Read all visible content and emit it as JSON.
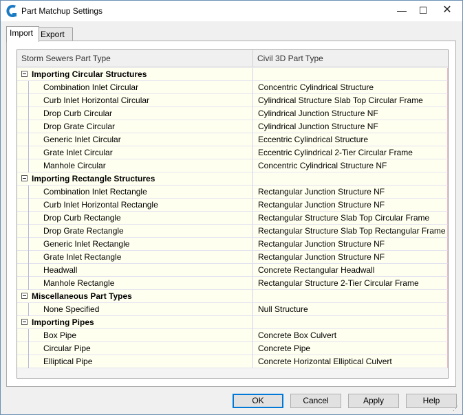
{
  "window": {
    "title": "Part Matchup Settings",
    "controls": {
      "minimize": "—",
      "maximize": "☐",
      "close": "✕"
    }
  },
  "tabs": [
    {
      "label": "Import",
      "active": true
    },
    {
      "label": "Export",
      "active": false
    }
  ],
  "table": {
    "headers": [
      "Storm Sewers Part Type",
      "Civil 3D Part Type"
    ],
    "groups": [
      {
        "label": "Importing Circular Structures",
        "items": [
          [
            "Combination Inlet Circular",
            "Concentric Cylindrical Structure"
          ],
          [
            "Curb Inlet Horizontal Circular",
            "Cylindrical Structure Slab Top Circular Frame"
          ],
          [
            "Drop Curb Circular",
            "Cylindrical Junction Structure NF"
          ],
          [
            "Drop Grate Circular",
            "Cylindrical Junction Structure NF"
          ],
          [
            "Generic Inlet Circular",
            "Eccentric Cylindrical Structure"
          ],
          [
            "Grate Inlet Circular",
            "Eccentric Cylindrical 2-Tier Circular Frame"
          ],
          [
            "Manhole Circular",
            "Concentric Cylindrical Structure NF"
          ]
        ]
      },
      {
        "label": "Importing Rectangle Structures",
        "items": [
          [
            "Combination Inlet Rectangle",
            "Rectangular Junction Structure NF"
          ],
          [
            "Curb Inlet Horizontal Rectangle",
            "Rectangular Junction Structure NF"
          ],
          [
            "Drop Curb Rectangle",
            "Rectangular Structure Slab Top Circular Frame"
          ],
          [
            "Drop Grate Rectangle",
            "Rectangular Structure Slab Top Rectangular Frame"
          ],
          [
            "Generic Inlet Rectangle",
            "Rectangular Junction Structure NF"
          ],
          [
            "Grate Inlet Rectangle",
            "Rectangular Junction Structure NF"
          ],
          [
            "Headwall",
            "Concrete Rectangular Headwall"
          ],
          [
            "Manhole Rectangle",
            "Rectangular Structure 2-Tier Circular Frame"
          ]
        ]
      },
      {
        "label": "Miscellaneous Part Types",
        "items": [
          [
            "None Specified",
            "Null Structure"
          ]
        ]
      },
      {
        "label": "Importing Pipes",
        "items": [
          [
            "Box Pipe",
            "Concrete Box Culvert"
          ],
          [
            "Circular Pipe",
            "Concrete Pipe"
          ],
          [
            "Elliptical Pipe",
            "Concrete Horizontal Elliptical Culvert"
          ]
        ]
      }
    ]
  },
  "buttons": {
    "ok": "OK",
    "cancel": "Cancel",
    "apply": "Apply",
    "help": "Help"
  },
  "colors": {
    "accent": "#0078d7",
    "row_bg": "#fffff0",
    "app_icon": "#1a7bc4"
  }
}
